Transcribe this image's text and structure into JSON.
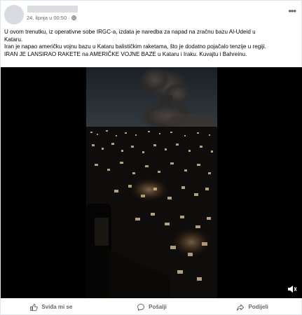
{
  "post": {
    "timestamp": "24. lipnja u 00:50",
    "privacy_separator": "·",
    "privacy_icon": "globe-icon",
    "more_icon": "more-options-icon",
    "more_label": "•••",
    "text_lines": [
      "U ovom trenutku, iz operativne sobe IRGC-a, izdata je naredba za napad na zračnu bazu Al-Udeid u",
      "Kataru.",
      "Iran je napao američku vojnu bazu u Kataru balističkim raketama, što je dodatno pojačalo tenzije u regiji.",
      "IRAN JE LANSIRAO RAKETE na AMERIČKE VOJNE BAZE u Kataru i Iraku. Kuvajtu i Bahreinu."
    ]
  },
  "video": {
    "mute_icon": "speaker-muted-icon"
  },
  "actions": {
    "like_label": "Sviđa mi se",
    "comment_label": "Pošalji",
    "share_label": "Podijeli"
  }
}
